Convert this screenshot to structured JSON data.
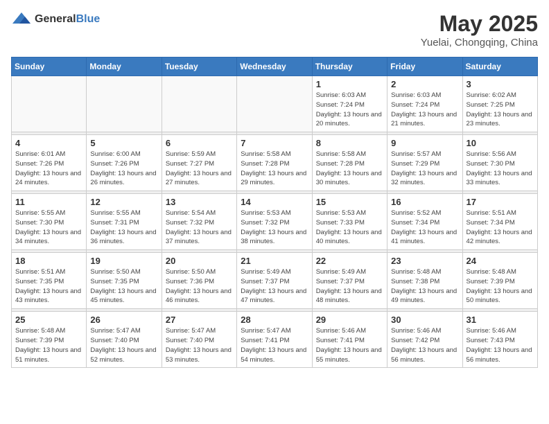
{
  "header": {
    "logo": {
      "general": "General",
      "blue": "Blue"
    },
    "title": "May 2025",
    "location": "Yuelai, Chongqing, China"
  },
  "calendar": {
    "weekdays": [
      "Sunday",
      "Monday",
      "Tuesday",
      "Wednesday",
      "Thursday",
      "Friday",
      "Saturday"
    ],
    "weeks": [
      {
        "days": [
          {
            "num": "",
            "info": ""
          },
          {
            "num": "",
            "info": ""
          },
          {
            "num": "",
            "info": ""
          },
          {
            "num": "",
            "info": ""
          },
          {
            "num": "1",
            "info": "Sunrise: 6:03 AM\nSunset: 7:24 PM\nDaylight: 13 hours\nand 20 minutes."
          },
          {
            "num": "2",
            "info": "Sunrise: 6:03 AM\nSunset: 7:24 PM\nDaylight: 13 hours\nand 21 minutes."
          },
          {
            "num": "3",
            "info": "Sunrise: 6:02 AM\nSunset: 7:25 PM\nDaylight: 13 hours\nand 23 minutes."
          }
        ]
      },
      {
        "days": [
          {
            "num": "4",
            "info": "Sunrise: 6:01 AM\nSunset: 7:26 PM\nDaylight: 13 hours\nand 24 minutes."
          },
          {
            "num": "5",
            "info": "Sunrise: 6:00 AM\nSunset: 7:26 PM\nDaylight: 13 hours\nand 26 minutes."
          },
          {
            "num": "6",
            "info": "Sunrise: 5:59 AM\nSunset: 7:27 PM\nDaylight: 13 hours\nand 27 minutes."
          },
          {
            "num": "7",
            "info": "Sunrise: 5:58 AM\nSunset: 7:28 PM\nDaylight: 13 hours\nand 29 minutes."
          },
          {
            "num": "8",
            "info": "Sunrise: 5:58 AM\nSunset: 7:28 PM\nDaylight: 13 hours\nand 30 minutes."
          },
          {
            "num": "9",
            "info": "Sunrise: 5:57 AM\nSunset: 7:29 PM\nDaylight: 13 hours\nand 32 minutes."
          },
          {
            "num": "10",
            "info": "Sunrise: 5:56 AM\nSunset: 7:30 PM\nDaylight: 13 hours\nand 33 minutes."
          }
        ]
      },
      {
        "days": [
          {
            "num": "11",
            "info": "Sunrise: 5:55 AM\nSunset: 7:30 PM\nDaylight: 13 hours\nand 34 minutes."
          },
          {
            "num": "12",
            "info": "Sunrise: 5:55 AM\nSunset: 7:31 PM\nDaylight: 13 hours\nand 36 minutes."
          },
          {
            "num": "13",
            "info": "Sunrise: 5:54 AM\nSunset: 7:32 PM\nDaylight: 13 hours\nand 37 minutes."
          },
          {
            "num": "14",
            "info": "Sunrise: 5:53 AM\nSunset: 7:32 PM\nDaylight: 13 hours\nand 38 minutes."
          },
          {
            "num": "15",
            "info": "Sunrise: 5:53 AM\nSunset: 7:33 PM\nDaylight: 13 hours\nand 40 minutes."
          },
          {
            "num": "16",
            "info": "Sunrise: 5:52 AM\nSunset: 7:34 PM\nDaylight: 13 hours\nand 41 minutes."
          },
          {
            "num": "17",
            "info": "Sunrise: 5:51 AM\nSunset: 7:34 PM\nDaylight: 13 hours\nand 42 minutes."
          }
        ]
      },
      {
        "days": [
          {
            "num": "18",
            "info": "Sunrise: 5:51 AM\nSunset: 7:35 PM\nDaylight: 13 hours\nand 43 minutes."
          },
          {
            "num": "19",
            "info": "Sunrise: 5:50 AM\nSunset: 7:35 PM\nDaylight: 13 hours\nand 45 minutes."
          },
          {
            "num": "20",
            "info": "Sunrise: 5:50 AM\nSunset: 7:36 PM\nDaylight: 13 hours\nand 46 minutes."
          },
          {
            "num": "21",
            "info": "Sunrise: 5:49 AM\nSunset: 7:37 PM\nDaylight: 13 hours\nand 47 minutes."
          },
          {
            "num": "22",
            "info": "Sunrise: 5:49 AM\nSunset: 7:37 PM\nDaylight: 13 hours\nand 48 minutes."
          },
          {
            "num": "23",
            "info": "Sunrise: 5:48 AM\nSunset: 7:38 PM\nDaylight: 13 hours\nand 49 minutes."
          },
          {
            "num": "24",
            "info": "Sunrise: 5:48 AM\nSunset: 7:39 PM\nDaylight: 13 hours\nand 50 minutes."
          }
        ]
      },
      {
        "days": [
          {
            "num": "25",
            "info": "Sunrise: 5:48 AM\nSunset: 7:39 PM\nDaylight: 13 hours\nand 51 minutes."
          },
          {
            "num": "26",
            "info": "Sunrise: 5:47 AM\nSunset: 7:40 PM\nDaylight: 13 hours\nand 52 minutes."
          },
          {
            "num": "27",
            "info": "Sunrise: 5:47 AM\nSunset: 7:40 PM\nDaylight: 13 hours\nand 53 minutes."
          },
          {
            "num": "28",
            "info": "Sunrise: 5:47 AM\nSunset: 7:41 PM\nDaylight: 13 hours\nand 54 minutes."
          },
          {
            "num": "29",
            "info": "Sunrise: 5:46 AM\nSunset: 7:41 PM\nDaylight: 13 hours\nand 55 minutes."
          },
          {
            "num": "30",
            "info": "Sunrise: 5:46 AM\nSunset: 7:42 PM\nDaylight: 13 hours\nand 56 minutes."
          },
          {
            "num": "31",
            "info": "Sunrise: 5:46 AM\nSunset: 7:43 PM\nDaylight: 13 hours\nand 56 minutes."
          }
        ]
      }
    ]
  }
}
